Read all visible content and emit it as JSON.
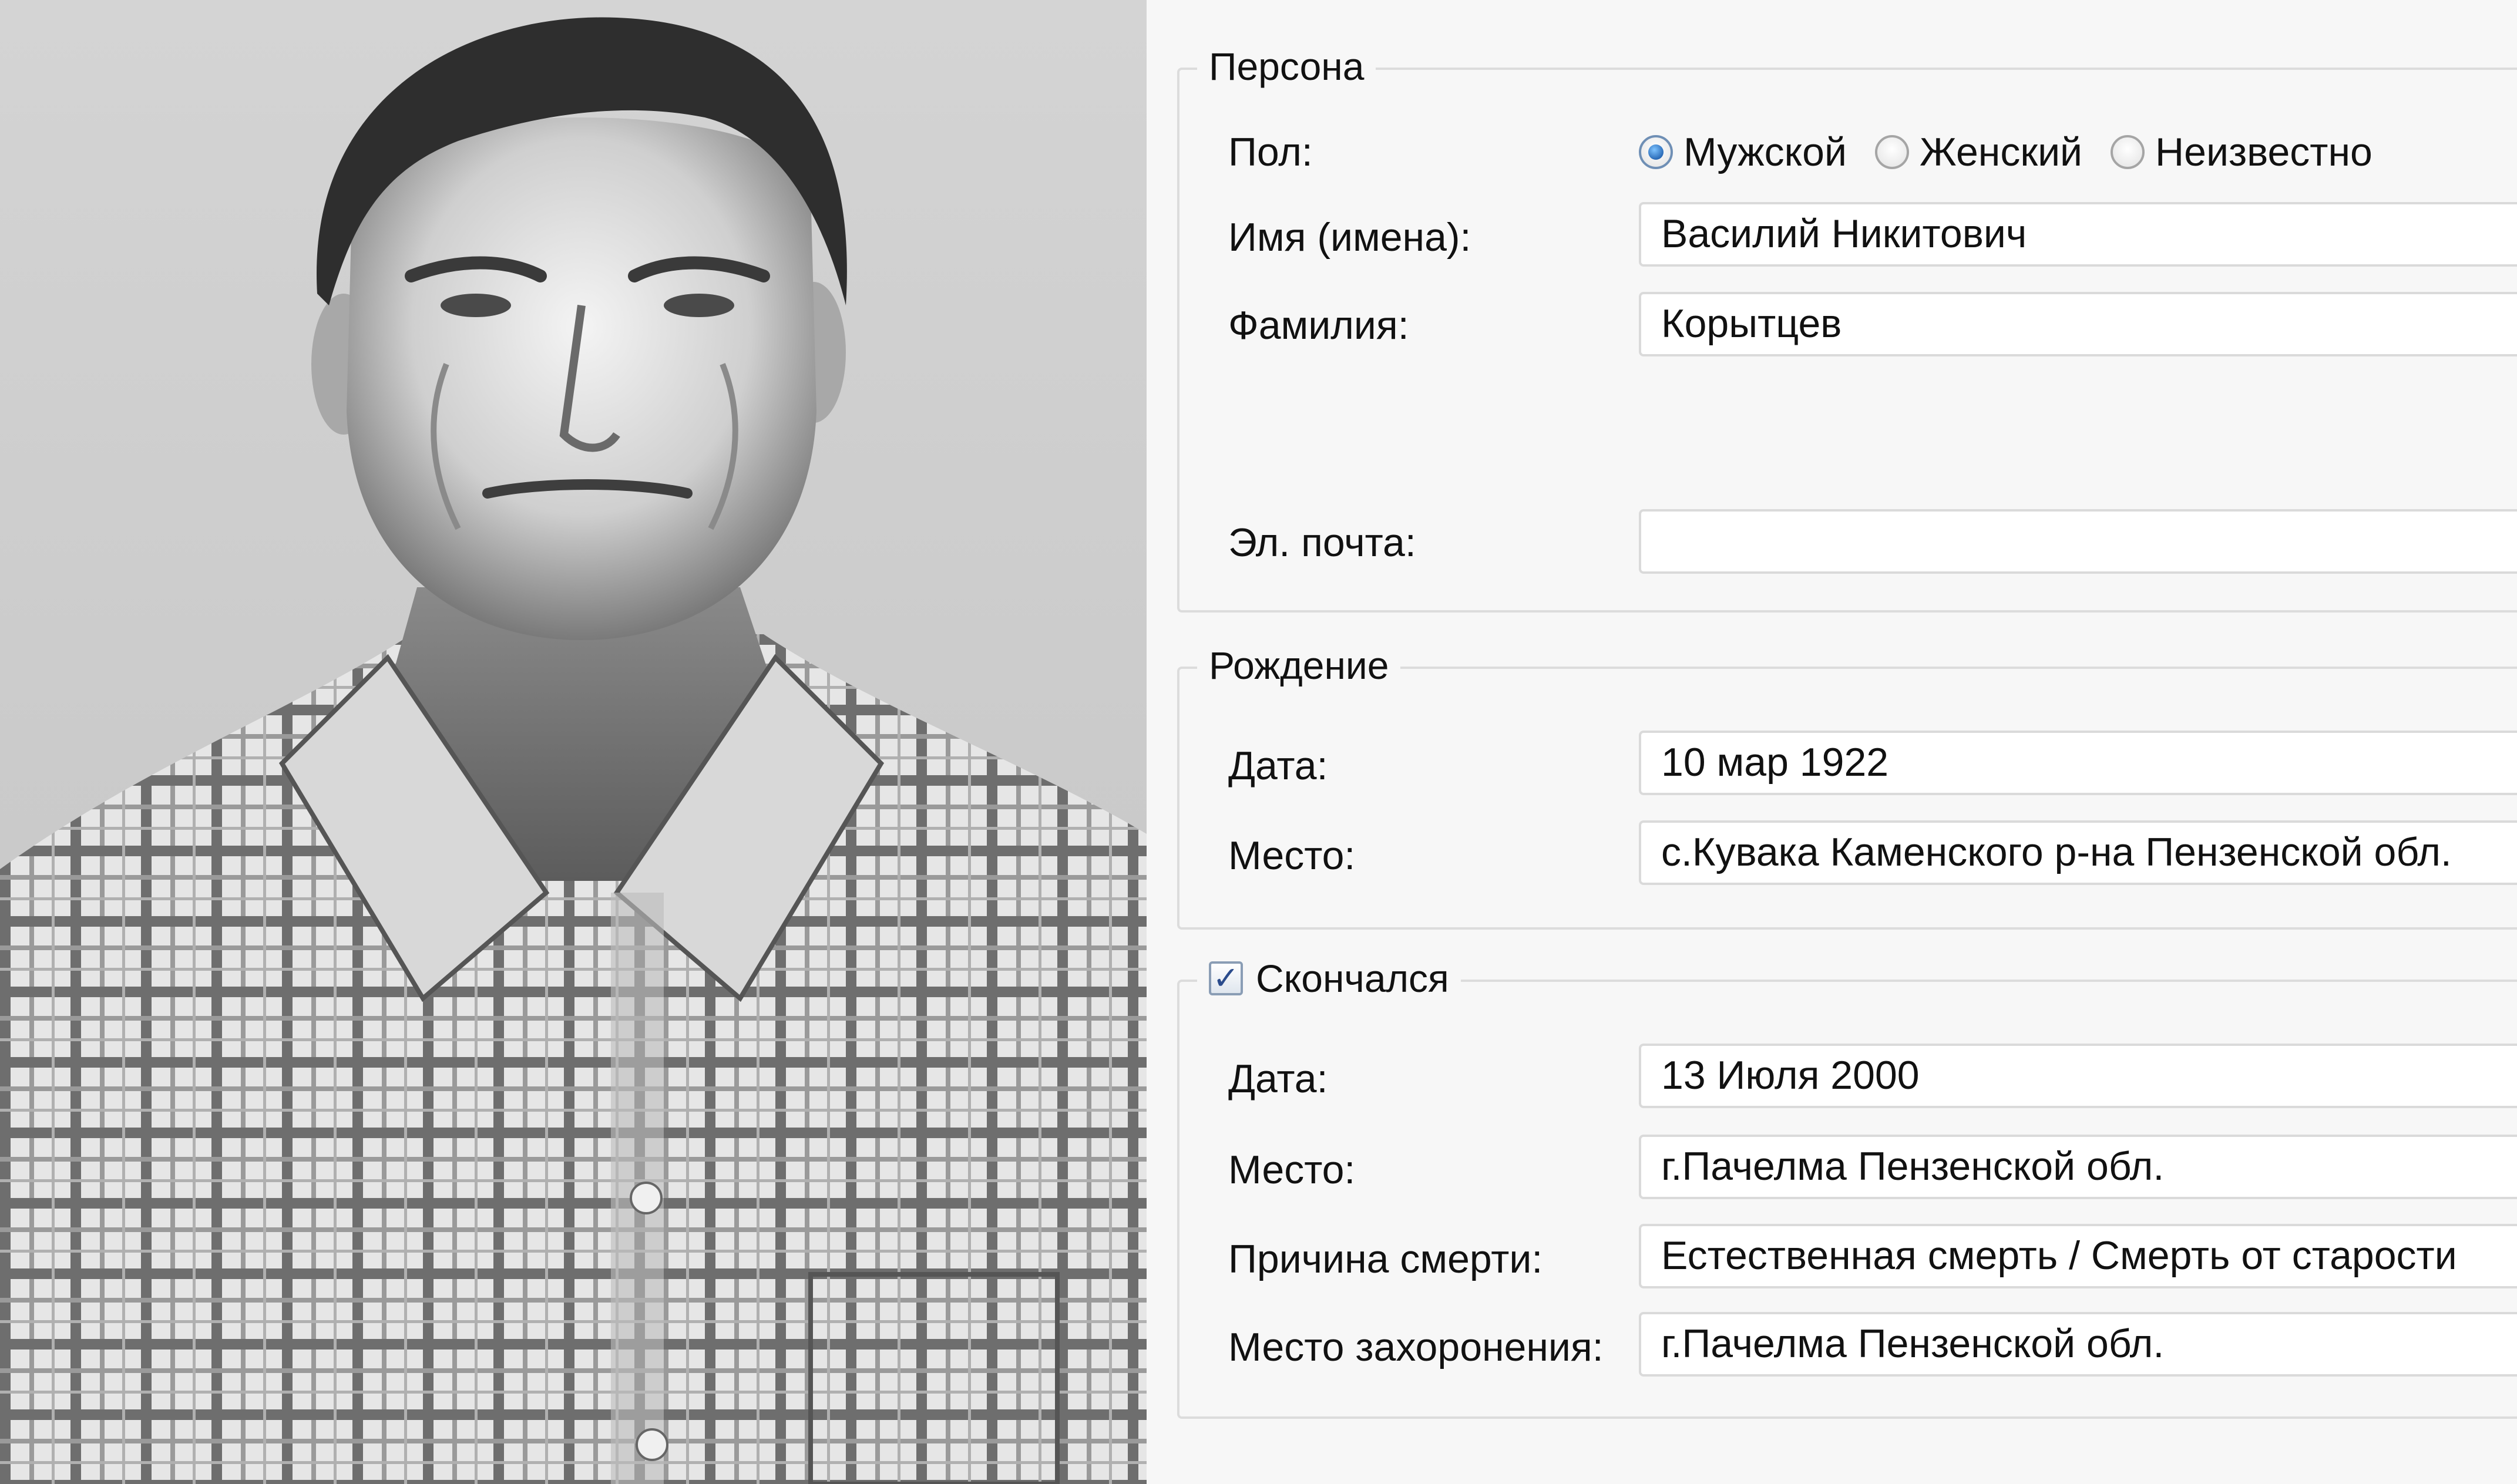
{
  "person": {
    "legend": "Персона",
    "gender_label": "Пол:",
    "gender_options": [
      "Мужской",
      "Женский",
      "Неизвестно"
    ],
    "gender_selected": "Мужской",
    "given_names_label": "Имя (имена):",
    "given_names": "Василий Никитович",
    "surname_label": "Фамилия:",
    "surname": "Корытцев",
    "email_label": "Эл. почта:",
    "email": ""
  },
  "birth": {
    "legend": "Рождение",
    "date_label": "Дата:",
    "date": "10 мар 1922",
    "place_label": "Место:",
    "place": "с.Кувака Каменского р-на Пензенской обл."
  },
  "death": {
    "legend": "Скончался",
    "checked": true,
    "date_label": "Дата:",
    "date": "13 Июля 2000",
    "place_label": "Место:",
    "place": "г.Пачелма Пензенской обл.",
    "cause_label": "Причина смерти:",
    "cause": "Естественная смерть / Смерть от старости",
    "burial_label": "Место захоронения:",
    "burial": "г.Пачелма Пензенской обл."
  },
  "colors": {
    "form_bg": "#f7f7f7",
    "border": "#dcdcdc",
    "radio_accent": "#1f5fae",
    "photo_bg": "#cfcfcf"
  }
}
